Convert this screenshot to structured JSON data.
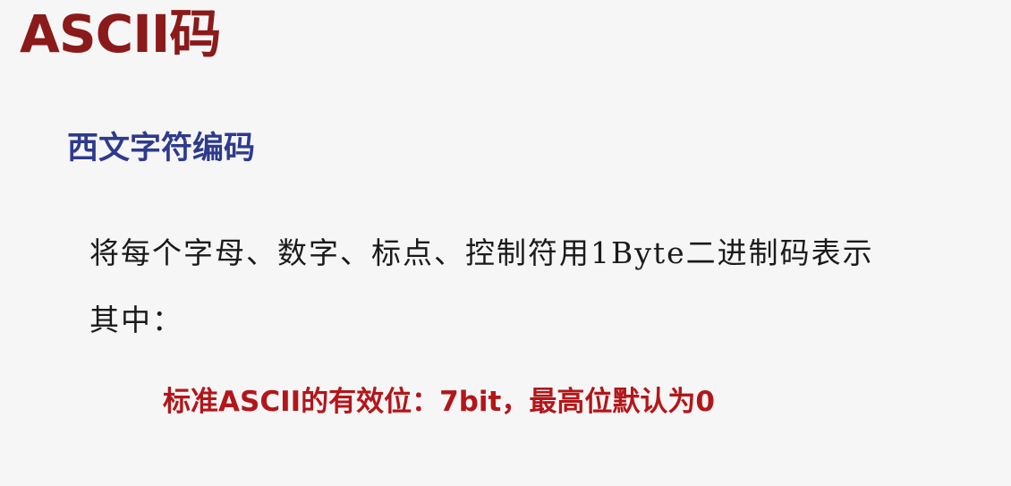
{
  "slide": {
    "title": "ASCII码",
    "subtitle": "西文字符编码",
    "body": {
      "line1": "将每个字母、数字、标点、控制符用1Byte二进制码表示",
      "line2": "其中："
    },
    "note": "标准ASCII的有效位：7bit，最高位默认为0"
  },
  "colors": {
    "title": "#8b1a1a",
    "subtitle": "#2e3a8c",
    "body": "#1a1a1a",
    "note": "#b3161a",
    "background": "#f6f6f6"
  }
}
